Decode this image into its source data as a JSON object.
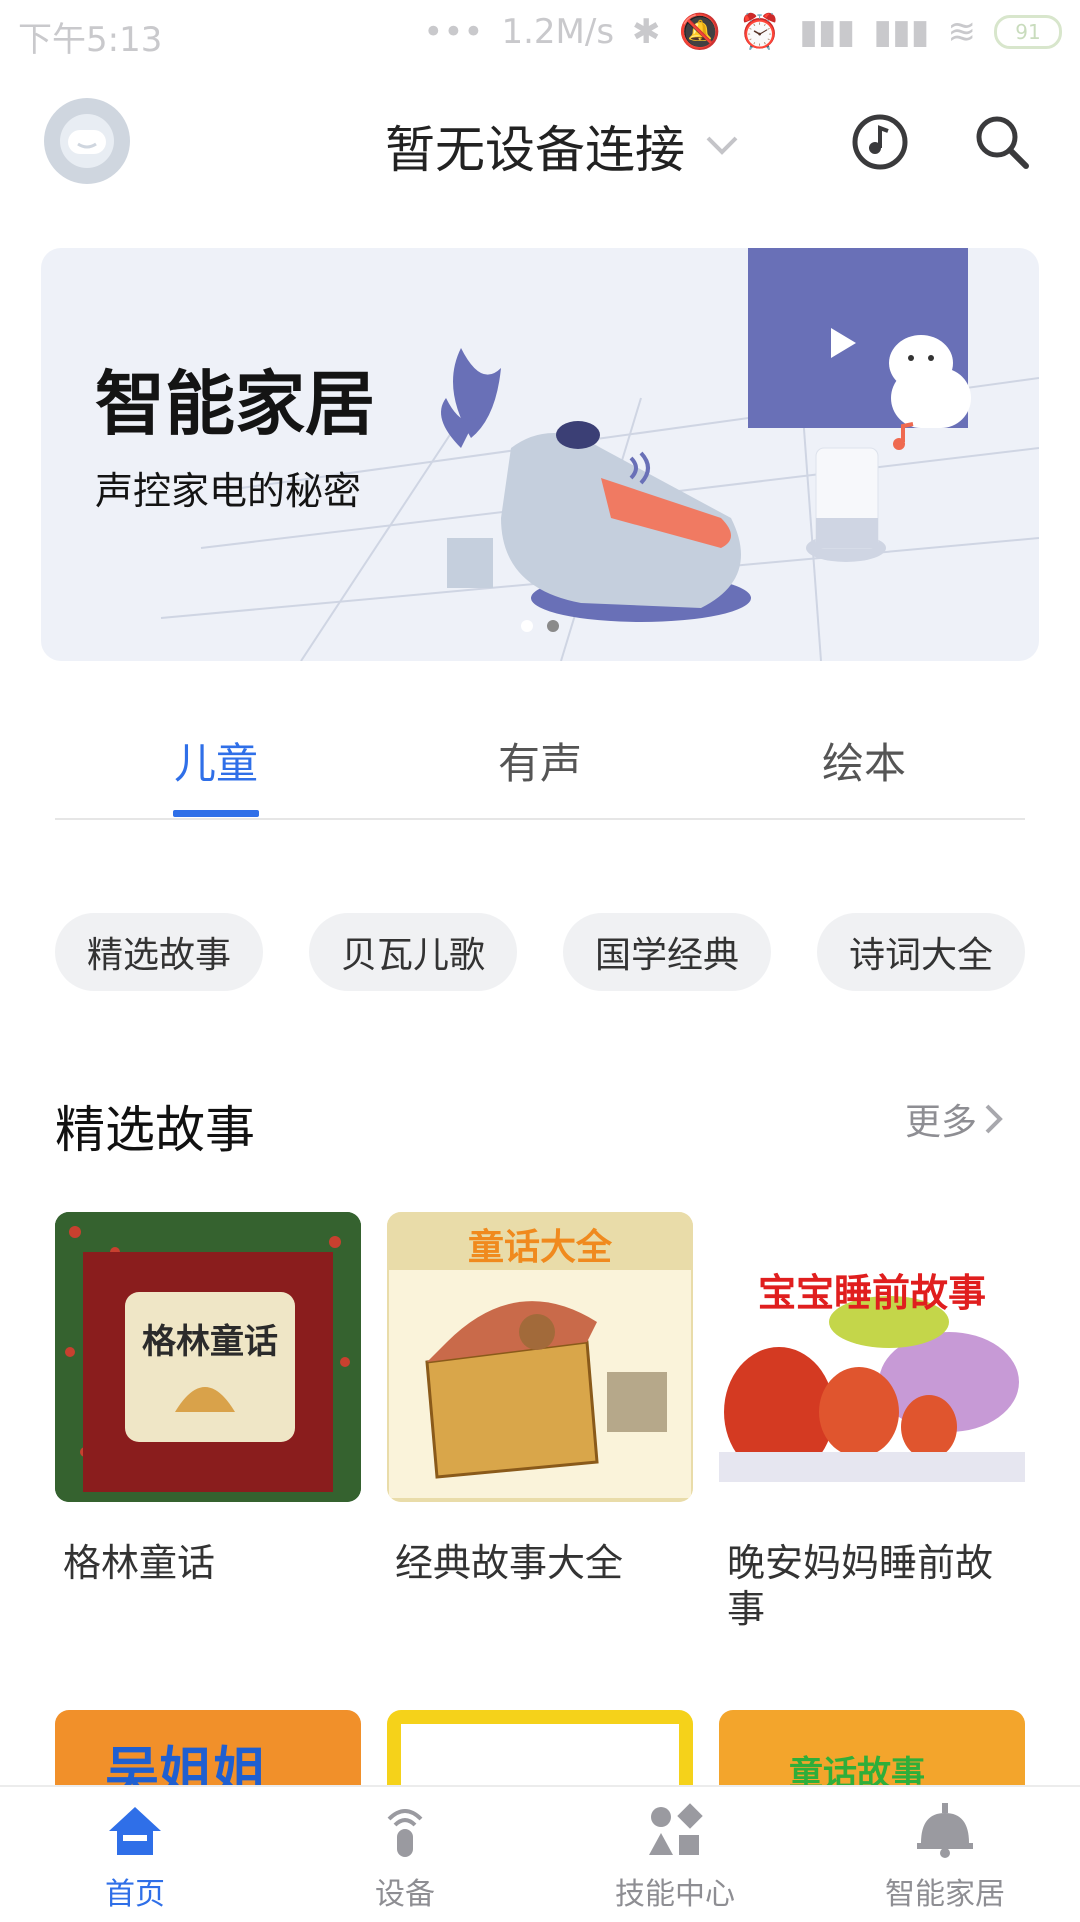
{
  "status_bar": {
    "time": "下午5:13",
    "network_speed": "1.2M/s",
    "battery": "91"
  },
  "header": {
    "device_label": "暂无设备连接"
  },
  "banner": {
    "title": "智能家居",
    "subtitle": "声控家电的秘密"
  },
  "tabs": [
    {
      "label": "儿童"
    },
    {
      "label": "有声"
    },
    {
      "label": "绘本"
    }
  ],
  "chips": [
    {
      "label": "精选故事"
    },
    {
      "label": "贝瓦儿歌"
    },
    {
      "label": "国学经典"
    },
    {
      "label": "诗词大全"
    }
  ],
  "section": {
    "title": "精选故事",
    "more_label": "更多"
  },
  "cards": [
    {
      "title": "格林童话",
      "cover_text": "格林童话"
    },
    {
      "title": "经典故事大全",
      "cover_text": "童话大全"
    },
    {
      "title": "晚安妈妈睡前故事",
      "cover_text": "宝宝睡前故事"
    }
  ],
  "row2_cards": [
    {
      "cover_text": "吴姐姐"
    },
    {
      "cover_text": ""
    },
    {
      "cover_text": "童话故事"
    }
  ],
  "bottom_nav": [
    {
      "label": "首页",
      "icon": "home-icon"
    },
    {
      "label": "设备",
      "icon": "device-icon"
    },
    {
      "label": "技能中心",
      "icon": "skills-icon"
    },
    {
      "label": "智能家居",
      "icon": "smart-home-icon"
    }
  ],
  "colors": {
    "accent": "#2f6fe8",
    "chip_bg": "#f0f1f3",
    "banner_bg": "#eef1f8"
  }
}
